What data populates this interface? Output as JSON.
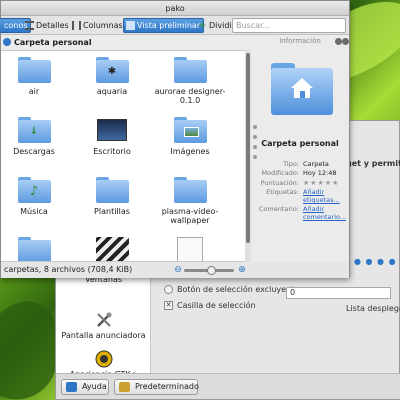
{
  "window": {
    "title": "pako"
  },
  "toolbar": {
    "icons_label": "conos",
    "details_label": "Detalles",
    "columns_label": "Columnas",
    "preview_label": "Vista preliminar",
    "split_label": "Dividir",
    "search_placeholder": "Buscar..."
  },
  "breadcrumb": {
    "label": "Carpeta personal"
  },
  "files": [
    {
      "name": "air",
      "icon": "folder-icon"
    },
    {
      "name": "aquaria",
      "icon": "folder-game-icon"
    },
    {
      "name": "aurorae designer-0.1.0",
      "icon": "folder-icon"
    },
    {
      "name": "Descargas",
      "icon": "folder-download-icon"
    },
    {
      "name": "Escritorio",
      "icon": "desktop-folder-icon"
    },
    {
      "name": "Imágenes",
      "icon": "folder-images-icon"
    },
    {
      "name": "Música",
      "icon": "folder-music-icon"
    },
    {
      "name": "Plantillas",
      "icon": "folder-icon"
    },
    {
      "name": "plasma-video-wallpaper",
      "icon": "folder-icon"
    }
  ],
  "info_panel": {
    "header": "Información",
    "title": "Carpeta personal",
    "rows": [
      {
        "key": "Tipo:",
        "value": "Carpeta"
      },
      {
        "key": "Modificado:",
        "value": "Hoy 12:48"
      },
      {
        "key": "Puntuación:",
        "value": ""
      },
      {
        "key": "Etiquetas:",
        "value": "Añadir etiquetas..."
      },
      {
        "key": "Comentario:",
        "value": "Añadir comentario..."
      }
    ]
  },
  "status": {
    "text": "carpetas, 8 archivos (708,4 KiB)",
    "zoom_fraction": 0.55
  },
  "background_window": {
    "sidebar_items": [
      {
        "label": "Ventanas"
      },
      {
        "label": "Pantalla anunciadora"
      },
      {
        "label": "Apariencia GTK+"
      }
    ],
    "radio_label": "Botón de selección excluyente",
    "checkbox_label": "Casilla de selección",
    "spin_value": "0",
    "dropdown_label": "Lista desplega",
    "widget_label": "get y permite",
    "help_button": "Ayuda",
    "default_button": "Predeterminado"
  },
  "colors": {
    "selection": "#2f78c8",
    "folder": "#5d9ae0",
    "link": "#2a63c8"
  }
}
